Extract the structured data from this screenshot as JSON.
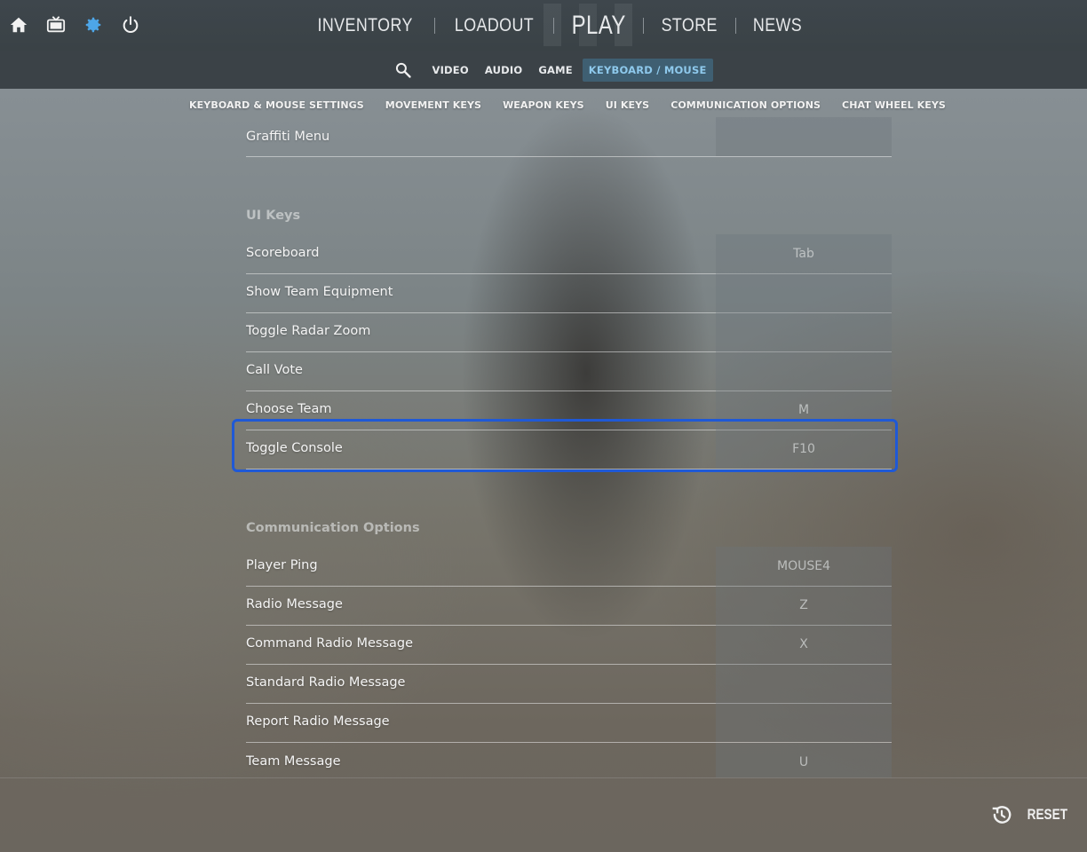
{
  "topbar": {
    "icons": [
      "home-icon",
      "tv-icon",
      "gear-icon",
      "power-icon"
    ],
    "nav": {
      "inventory": "INVENTORY",
      "loadout": "LOADOUT",
      "play": "PLAY",
      "store": "STORE",
      "news": "NEWS"
    }
  },
  "subnav": {
    "tabs": [
      "VIDEO",
      "AUDIO",
      "GAME",
      "KEYBOARD / MOUSE"
    ],
    "active": "KEYBOARD / MOUSE",
    "active_color": "#8ec9ec"
  },
  "sections_nav": [
    "KEYBOARD & MOUSE SETTINGS",
    "MOVEMENT KEYS",
    "WEAPON KEYS",
    "UI KEYS",
    "COMMUNICATION OPTIONS",
    "CHAT WHEEL KEYS"
  ],
  "list": {
    "partial_row": {
      "label": "Graffiti Menu",
      "key": ""
    },
    "ui_keys": {
      "title": "UI Keys",
      "rows": [
        {
          "label": "Scoreboard",
          "key": "Tab"
        },
        {
          "label": "Show Team Equipment",
          "key": ""
        },
        {
          "label": "Toggle Radar Zoom",
          "key": ""
        },
        {
          "label": "Call Vote",
          "key": ""
        },
        {
          "label": "Choose Team",
          "key": "M"
        },
        {
          "label": "Toggle Console",
          "key": "F10"
        }
      ]
    },
    "communication": {
      "title": "Communication Options",
      "rows": [
        {
          "label": "Player Ping",
          "key": "MOUSE4"
        },
        {
          "label": "Radio Message",
          "key": "Z"
        },
        {
          "label": "Command Radio Message",
          "key": "X"
        },
        {
          "label": "Standard Radio Message",
          "key": ""
        },
        {
          "label": "Report Radio Message",
          "key": ""
        },
        {
          "label": "Team Message",
          "key": "U"
        }
      ]
    }
  },
  "highlight_color": "#1f59d6",
  "footer": {
    "reset_label": "RESET"
  }
}
